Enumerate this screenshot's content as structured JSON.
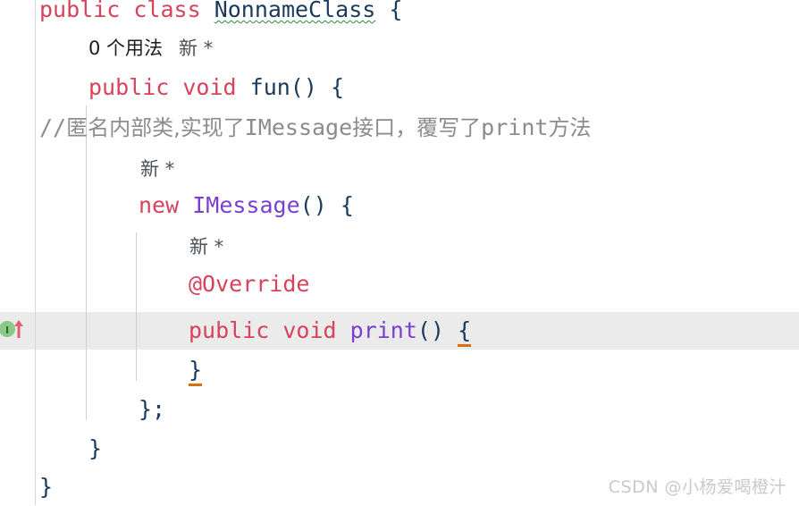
{
  "editor": {
    "language": "Java",
    "background_color": "#ffffff",
    "current_line_highlight_color": "#ebebeb",
    "gutter_border_color": "#d6d6d6",
    "indent_guide_color": "#cfcfcf"
  },
  "colors": {
    "keyword": "#d6435b",
    "class_name": "#1a3a5c",
    "type_reference": "#7b3fd0",
    "method_name": "#7b3fd0",
    "annotation": "#d6435b",
    "comment": "#8c8c8c",
    "punctuation": "#1a3a5c",
    "brace_match_underline": "#e06c10",
    "typo_wavy_underline": "#2e8b3d",
    "gutter_icon_circle": "#89c98a",
    "gutter_icon_arrow": "#e0616b",
    "watermark": "#c9c9c9"
  },
  "gutter": {
    "implementing_method_icon": {
      "glyph": "I",
      "arrow": "↑",
      "tooltip_name": "implementing-method-marker"
    }
  },
  "code": {
    "line1": {
      "kw_public": "public",
      "kw_class": "class",
      "class_name": "NonnameClass",
      "brace": "{"
    },
    "line2_hint": {
      "usages": "0 个用法",
      "author": "新 *"
    },
    "line3": {
      "kw_public": "public",
      "kw_void": "void",
      "method": "fun()",
      "brace": "{"
    },
    "line4_comment": {
      "slashes": "//",
      "text_a": "匿名内部类",
      "text_b": ",实现了",
      "ident_a": "IMessage",
      "text_c": "接口，覆写了",
      "ident_b": "print",
      "text_d": "方法"
    },
    "line5_hint": {
      "author": "新 *"
    },
    "line6": {
      "kw_new": "new",
      "type": "IMessage",
      "parens": "()",
      "brace": "{"
    },
    "line7_hint": {
      "author": "新 *"
    },
    "line8": {
      "annotation": "@Override"
    },
    "line9": {
      "kw_public": "public",
      "kw_void": "void",
      "method": "print",
      "parens": "()",
      "brace": "{"
    },
    "line10": {
      "brace": "}"
    },
    "line11": {
      "brace": "};"
    },
    "line12": {
      "brace": "}"
    },
    "line13": {
      "brace": "}"
    }
  },
  "watermark": {
    "text": "CSDN @小杨爱喝橙汁"
  }
}
